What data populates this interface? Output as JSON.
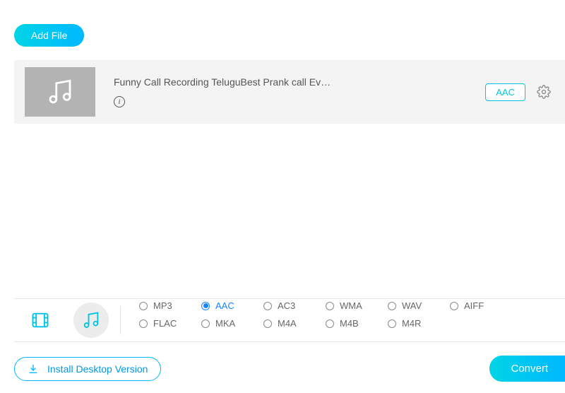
{
  "header": {
    "add_file_label": "Add File"
  },
  "file": {
    "title": "Funny Call Recording TeluguBest Prank call Ev…",
    "format_badge": "AAC"
  },
  "format_panel": {
    "options_row1": [
      "MP3",
      "AAC",
      "AC3",
      "WMA",
      "WAV",
      "AIFF",
      "FLAC"
    ],
    "options_row2": [
      "MKA",
      "M4A",
      "M4B",
      "M4R"
    ],
    "selected": "AAC"
  },
  "footer": {
    "install_label": "Install Desktop Version",
    "convert_label": "Convert"
  }
}
